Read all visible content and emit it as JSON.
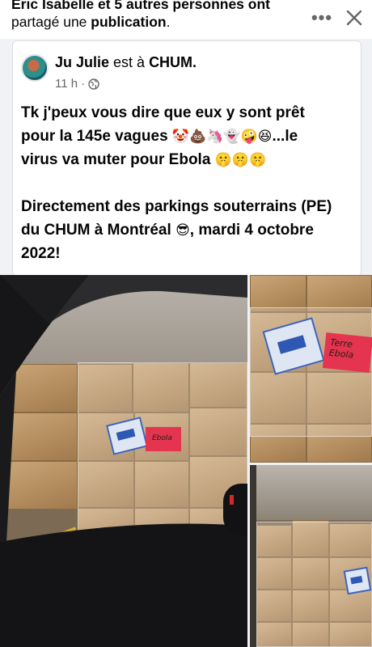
{
  "share_header": {
    "line1_prefix": "Eric Isabelle et 5 autres personnes ont",
    "line2_prefix": "partagé une ",
    "line2_bold": "publication",
    "line2_suffix": ".",
    "more_icon": "more-horizontal-icon",
    "close_icon": "close-icon"
  },
  "post": {
    "author": "Ju Julie",
    "verb": " est à ",
    "place": "CHUM.",
    "time": "11 h",
    "separator": " · ",
    "privacy_icon": "globe-icon",
    "line1": "Tk j'peux vous dire que eux y sont prêt",
    "line2_text": "pour la 145e vagues ",
    "line2_emojis": "🤡💩🦄👻🤪😆",
    "line2_suffix": "...le",
    "line3_text": "virus va muter pour Ebola ",
    "line3_emojis": "🤫🤫🤫",
    "para2_line1": "Directement des parkings souterrains (PE)",
    "para2_line2_text": "du CHUM à Montréal ",
    "para2_line2_emoji": "😎",
    "para2_line2_suffix": ", mardi 4 octobre",
    "para2_line3": "2022!"
  },
  "photos": {
    "main_label_text": "Ebola",
    "topright_label_line1": "Terre",
    "topright_label_line2": "Ebola"
  },
  "colors": {
    "background": "#f0f2f5",
    "card": "#ffffff",
    "secondary_text": "#65676b",
    "label_red": "#e53450",
    "label_blue": "#2f58b4"
  }
}
